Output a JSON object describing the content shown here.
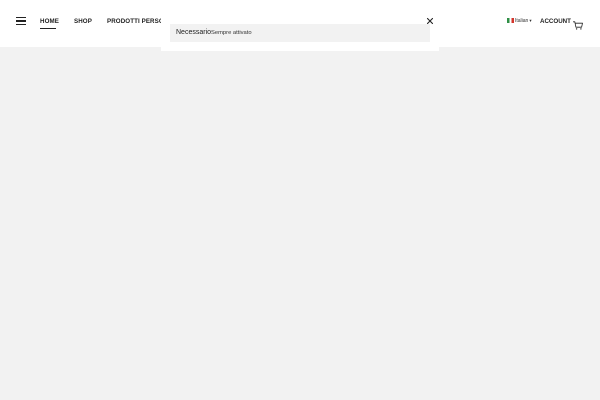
{
  "header": {
    "menu_icon": "hamburger-menu-icon",
    "nav": [
      {
        "label": "HOME",
        "active": true
      },
      {
        "label": "SHOP",
        "active": false
      },
      {
        "label": "PRODOTTI PERSONALI",
        "active": false
      }
    ],
    "language": {
      "label": "Italian",
      "flag_icon": "italy-flag-icon",
      "caret_icon": "caret-down-icon"
    },
    "account_label": "ACCOUNT",
    "cart_icon": "shopping-cart-icon"
  },
  "cookie_panel": {
    "close_icon": "close-icon",
    "category": {
      "title": "Necessario",
      "status": "Sempre attivato"
    }
  },
  "colors": {
    "page_background": "#f2f2f2",
    "header_background": "#ffffff",
    "text": "#222222"
  }
}
